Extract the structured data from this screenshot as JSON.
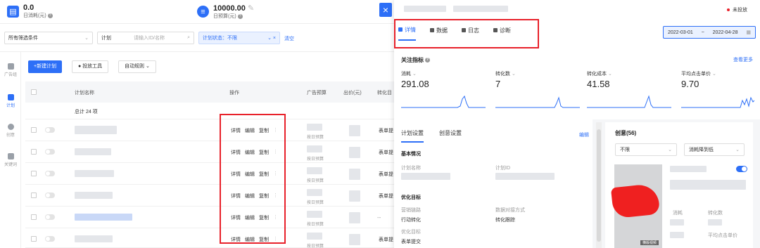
{
  "stats": {
    "spend": {
      "value": "0.0",
      "label": "日消耗(元)"
    },
    "budget": {
      "value": "10000.00",
      "label": "日预算(元)"
    }
  },
  "filters": {
    "all_conditions": "所有筛选条件",
    "plan": "计划",
    "search_placeholder": "请输入ID/名称",
    "plan_status": "计划状态：不限",
    "clear": "清空"
  },
  "nav": {
    "items": [
      {
        "label": "广告组"
      },
      {
        "label": "计划"
      },
      {
        "label": "创意"
      },
      {
        "label": "关键词"
      }
    ]
  },
  "toolbar": {
    "new_plan": "+新建计划",
    "tools": "投放工具",
    "auto_rules": "自动规则"
  },
  "table": {
    "headers": {
      "name": "计划名称",
      "ops": "操作",
      "budget": "广告预算",
      "bid": "出价(元)",
      "conv": "转化目"
    },
    "total": "总计 24 项",
    "op_detail": "详情",
    "op_edit": "编辑",
    "op_copy": "复制",
    "budget_sub": "按日预算",
    "form_label": "表单提",
    "dashes": "--"
  },
  "drawer": {
    "status": "未投放",
    "tabs": [
      {
        "label": "详情"
      },
      {
        "label": "数据"
      },
      {
        "label": "日志"
      },
      {
        "label": "诊断"
      }
    ],
    "date_start": "2022-03-01",
    "date_sep": "~",
    "date_end": "2022-04-28",
    "key_metrics": "关注指标",
    "see_more": "查看更多",
    "metrics": [
      {
        "label": "消耗",
        "value": "291.08"
      },
      {
        "label": "转化数",
        "value": "7"
      },
      {
        "label": "转化成本",
        "value": "41.58"
      },
      {
        "label": "平均点击单价",
        "value": "9.70"
      }
    ],
    "subtabs": {
      "plan_settings": "计划设置",
      "creative_settings": "创意设置",
      "edit": "编辑"
    },
    "basic": {
      "title": "基本情况",
      "plan_name": "计划名称",
      "plan_id": "计划ID"
    },
    "optimize": {
      "title": "优化目标",
      "marketing_link": "营销链路",
      "marketing_value": "行动转化",
      "data_method": "数据对接方式",
      "data_value": "转化跟踪",
      "goal": "优化目标",
      "goal_value": "表单提交"
    },
    "creative": {
      "title": "创意(56)",
      "filter1": "不限",
      "filter2": "消耗降到低",
      "img_tag": "横版视频",
      "spend": "消耗",
      "conv": "转化数",
      "avg_cpc": "平均点击单价"
    }
  }
}
